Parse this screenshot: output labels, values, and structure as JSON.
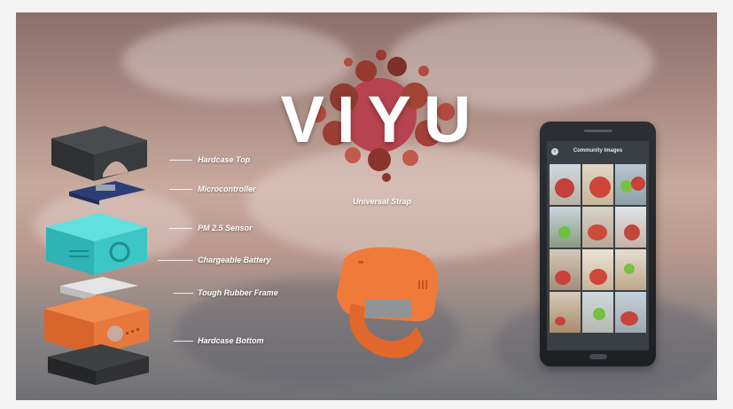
{
  "title": "VIYU",
  "device_logo": "VIYU",
  "labels": {
    "hardcase_top": "Hardcase Top",
    "microcontroller": "Microcontroller",
    "pm_sensor": "PM 2.5 Sensor",
    "battery": "Chargeable Battery",
    "frame": "Tough Rubber Frame",
    "hardcase_bottom": "Hardcase Bottom",
    "strap": "Universal Strap"
  },
  "phone": {
    "screen_title": "Community Images",
    "back_icon": "back-arrow-icon"
  },
  "colors": {
    "case": "#3a3b3d",
    "sensor": "#3cc7c7",
    "frame": "#e8773c",
    "strap": "#f07a3a",
    "blob": "#b6434f"
  }
}
